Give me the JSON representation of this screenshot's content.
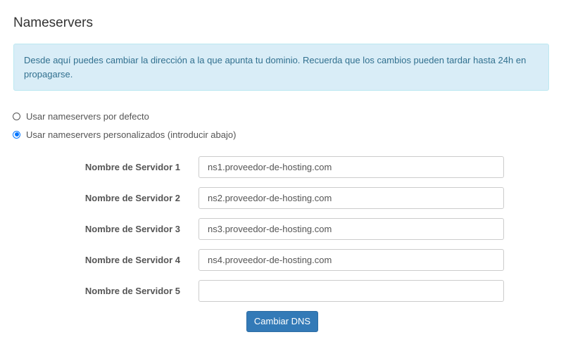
{
  "page": {
    "title": "Nameservers"
  },
  "info": {
    "message": "Desde aquí puedes cambiar la dirección a la que apunta tu dominio. Recuerda que los cambios pueden tardar hasta 24h en propagarse."
  },
  "options": [
    {
      "label": "Usar nameservers por defecto",
      "checked": false
    },
    {
      "label": "Usar nameservers personalizados (introducir abajo)",
      "checked": true
    }
  ],
  "nameservers": [
    {
      "label": "Nombre de Servidor 1",
      "value": "ns1.proveedor-de-hosting.com"
    },
    {
      "label": "Nombre de Servidor 2",
      "value": "ns2.proveedor-de-hosting.com"
    },
    {
      "label": "Nombre de Servidor 3",
      "value": "ns3.proveedor-de-hosting.com"
    },
    {
      "label": "Nombre de Servidor 4",
      "value": "ns4.proveedor-de-hosting.com"
    },
    {
      "label": "Nombre de Servidor 5",
      "value": ""
    }
  ],
  "submit": {
    "label": "Cambiar DNS"
  },
  "colors": {
    "primary": "#337ab7",
    "info_bg": "#d9edf7",
    "info_text": "#31708f",
    "radio_accent": "#0075ff"
  }
}
